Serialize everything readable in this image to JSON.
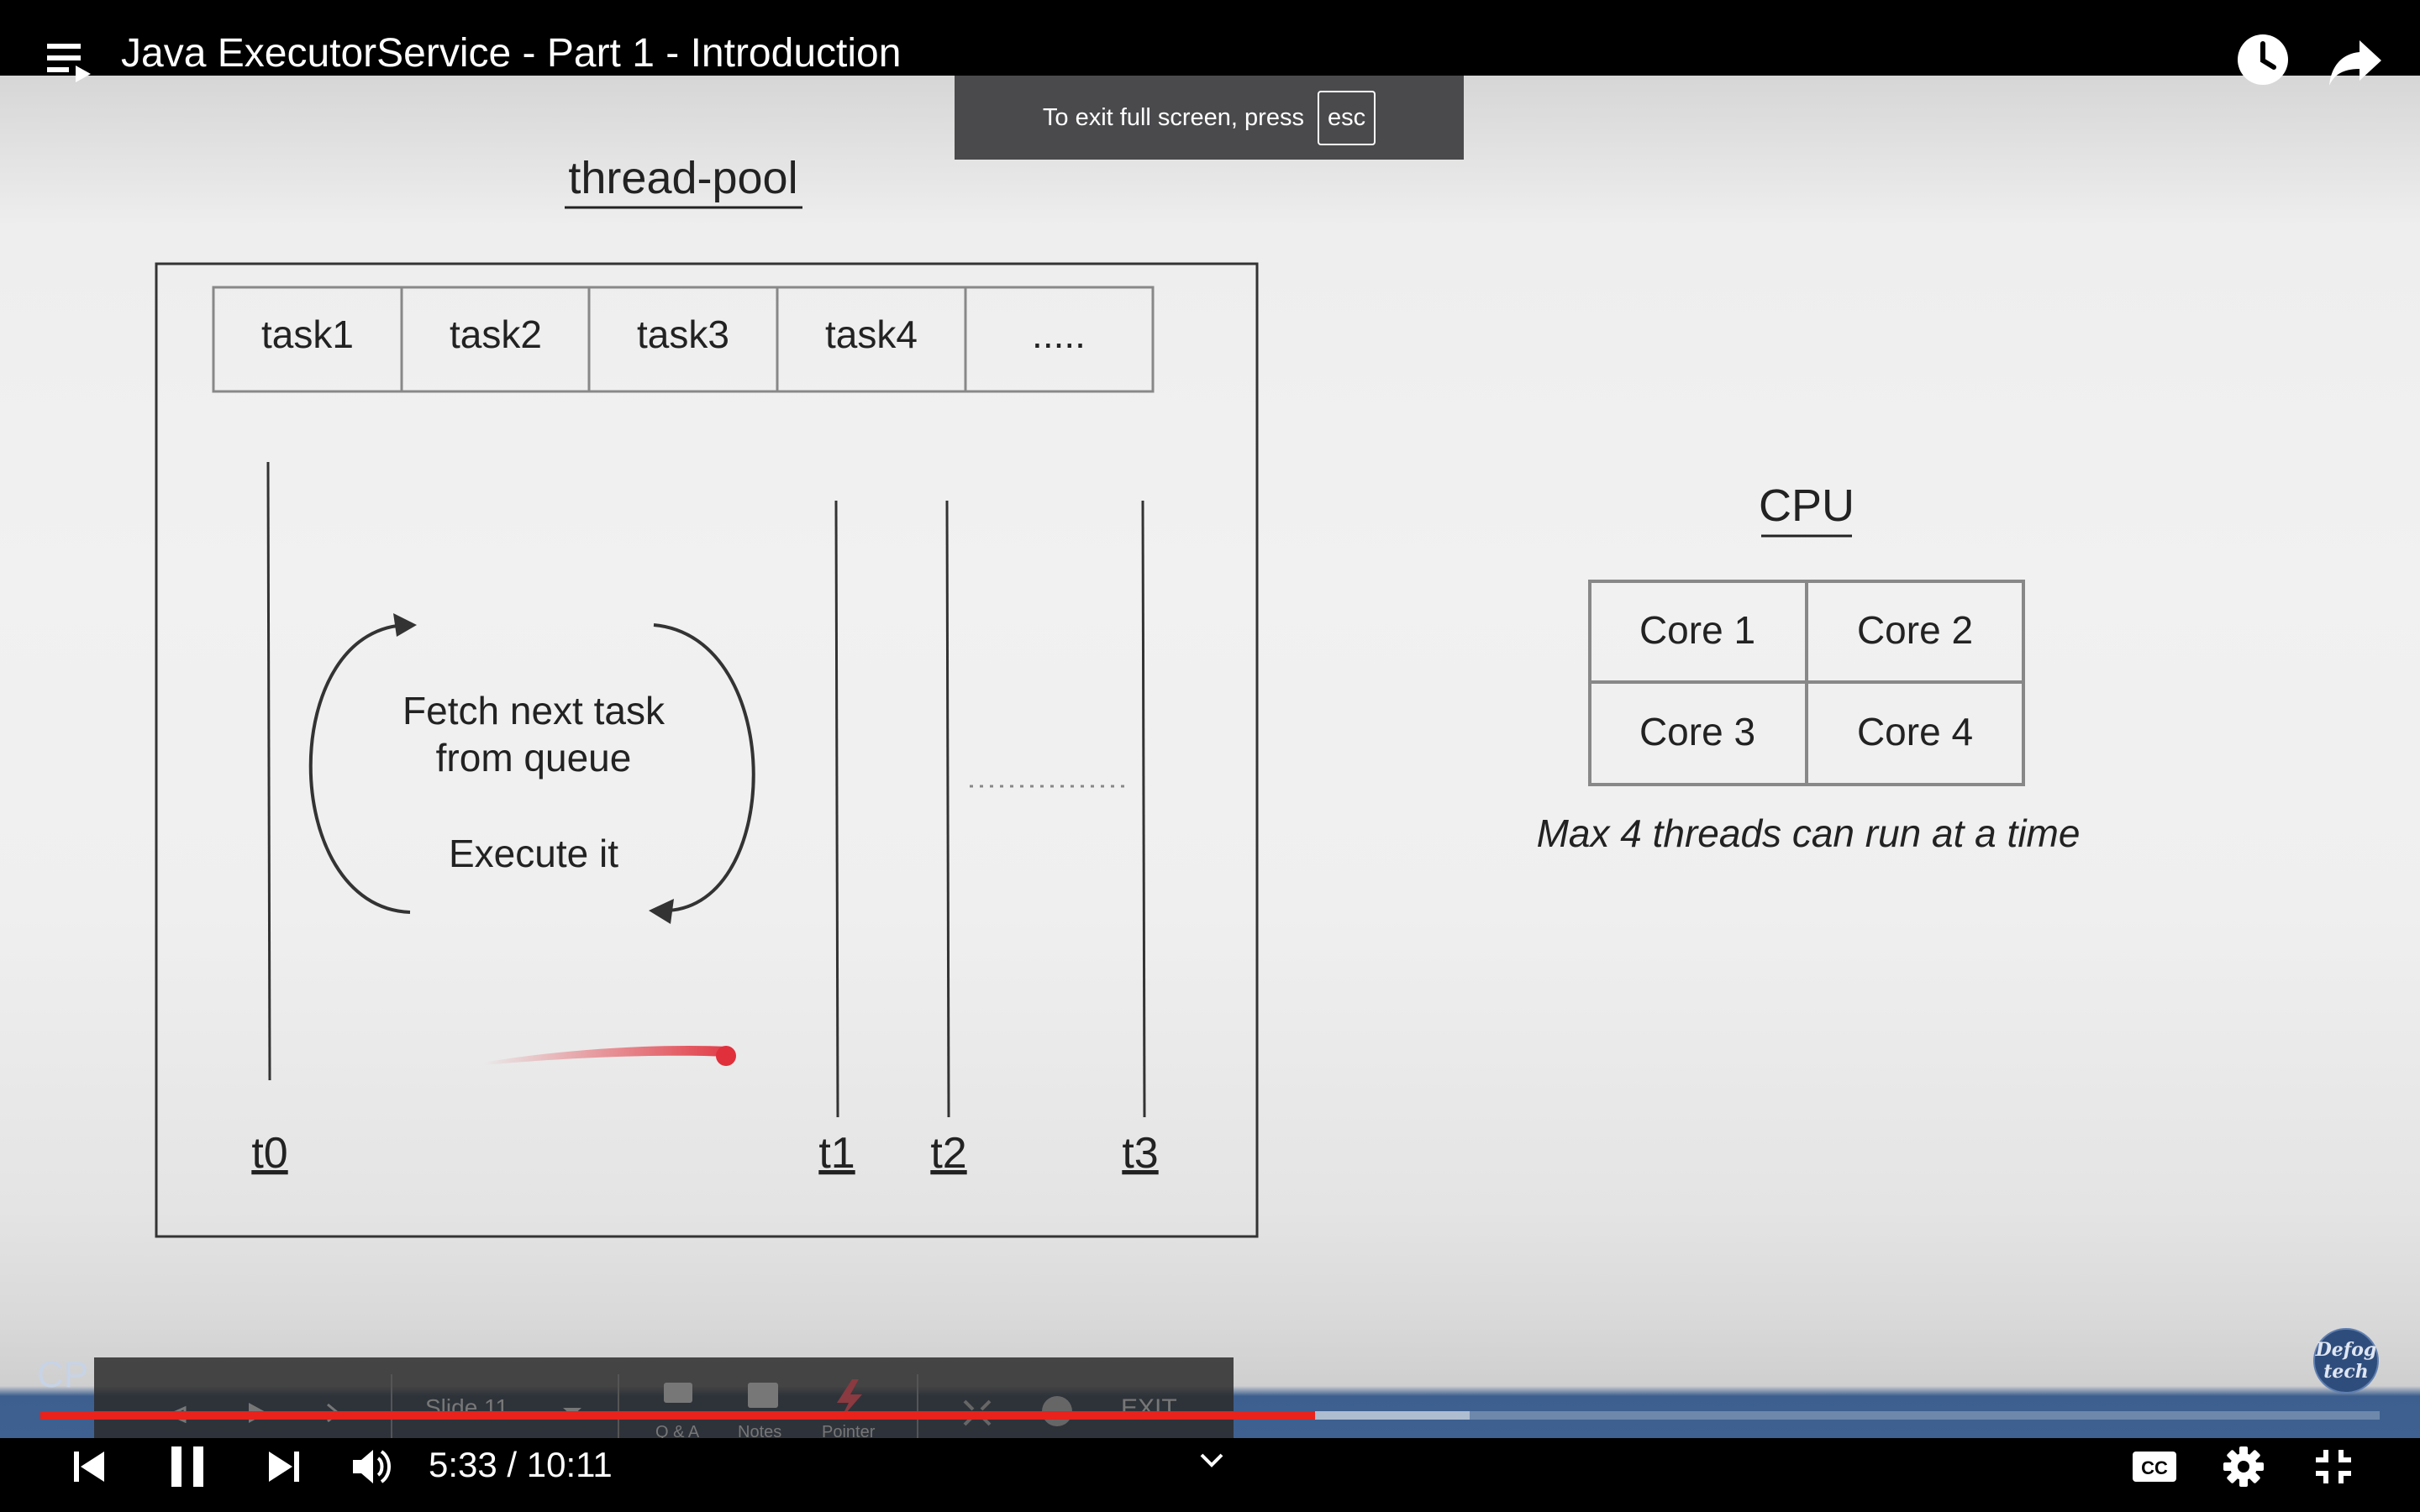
{
  "window": {
    "video_title": "Java ExecutorService - Part 1 - Introduction"
  },
  "toast": {
    "text": "To exit full screen, press",
    "key": "esc"
  },
  "slide": {
    "pool_title": "thread-pool",
    "queue_tasks": [
      "task1",
      "task2",
      "task3",
      "task4",
      "....."
    ],
    "loop_line1": "Fetch next task",
    "loop_line2": "from queue",
    "loop_line3": "Execute it",
    "threads": [
      "t0",
      "t1",
      "t2",
      "t3"
    ],
    "cpu_title": "CPU",
    "cores": [
      "Core 1",
      "Core 2",
      "Core 3",
      "Core 4"
    ],
    "cpu_caption": "Max 4 threads can run at a time"
  },
  "presenter_strip": {
    "label": "CP",
    "slide_label": "Slide 11",
    "toolbar_items": [
      "Q & A",
      "Notes",
      "Pointer"
    ],
    "exit_label": "EXIT",
    "brand_badge": "Defog tech"
  },
  "player": {
    "current_time": "5:33",
    "duration": "10:11",
    "time_separator": " / ",
    "progress_fraction": 0.545,
    "buffered_fraction": 0.611,
    "icons": [
      "previous-icon",
      "pause-icon",
      "next-icon",
      "volume-icon",
      "chevron-down-icon",
      "captions-icon",
      "settings-icon",
      "exit-fullscreen-icon",
      "playlist-icon",
      "watch-later-icon",
      "share-icon"
    ]
  },
  "colors": {
    "progress": "#e8221c",
    "strip": "#3f6191",
    "toast": "#4a4a4d"
  }
}
